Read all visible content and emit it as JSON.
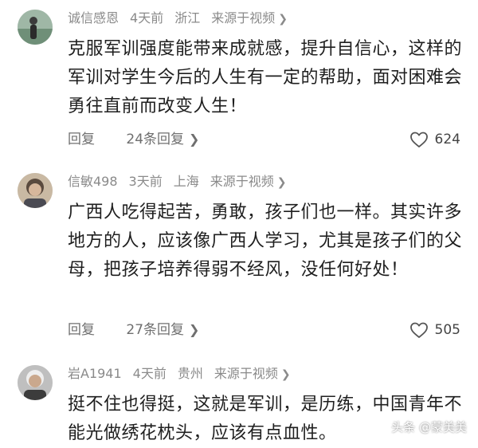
{
  "comments": [
    {
      "username": "诚信感恩",
      "time": "4天前",
      "location": "浙江",
      "source": "来源于视频",
      "text": "克服军训强度能带来成就感，提升自信心，这样的军训对学生今后的人生有一定的帮助，面对困难会勇往直前而改变人生！",
      "reply_label": "回复",
      "replies": "24条回复",
      "likes": "624"
    },
    {
      "username": "信敏498",
      "time": "3天前",
      "location": "上海",
      "source": "来源于视频",
      "text": "广西人吃得起苦，勇敢，孩子们也一样。其实许多地方的人，应该像广西人学习，尤其是孩子们的父母，把孩子培养得弱不经风，没任何好处！",
      "reply_label": "回复",
      "replies": "27条回复",
      "likes": "505"
    },
    {
      "username": "岩A1941",
      "time": "4天前",
      "location": "贵州",
      "source": "来源于视频",
      "text": "挺不住也得挺，这就是军训，是历练，中国青年不能光做绣花枕头，应该有点血性。"
    }
  ],
  "watermark": "头条 @蒙美美",
  "icons": {
    "chevron": "chevron-right-icon",
    "like": "heart-outline-icon"
  },
  "colors": {
    "meta": "#8a8a8a",
    "text": "#1f1f1f",
    "action": "#6f6f6f"
  }
}
